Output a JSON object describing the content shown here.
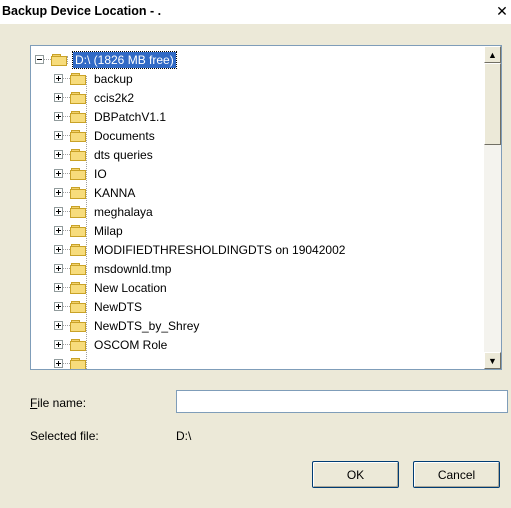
{
  "window": {
    "title": "Backup Device Location - .",
    "close_glyph": "✕"
  },
  "tree": {
    "root_label": "D:\\ (1826 MB free)",
    "items": [
      "backup",
      "ccis2k2",
      "DBPatchV1.1",
      "Documents",
      "dts queries",
      "IO",
      "KANNA",
      "meghalaya",
      "Milap",
      "MODIFIEDTHRESHOLDINGDTS on 19042002",
      "msdownld.tmp",
      "New Location",
      "NewDTS",
      "NewDTS_by_Shrey",
      "OSCOM Role"
    ]
  },
  "form": {
    "file_name_label_first": "F",
    "file_name_label_rest": "ile name:",
    "file_name_value": "",
    "selected_file_label": "Selected file:",
    "selected_file_value": "D:\\"
  },
  "buttons": {
    "ok": "OK",
    "cancel": "Cancel"
  },
  "icons": {
    "scroll_up": "▲",
    "scroll_down": "▼",
    "folder": "folder-icon",
    "expand": "plus-box-icon",
    "collapse": "minus-box-icon"
  }
}
